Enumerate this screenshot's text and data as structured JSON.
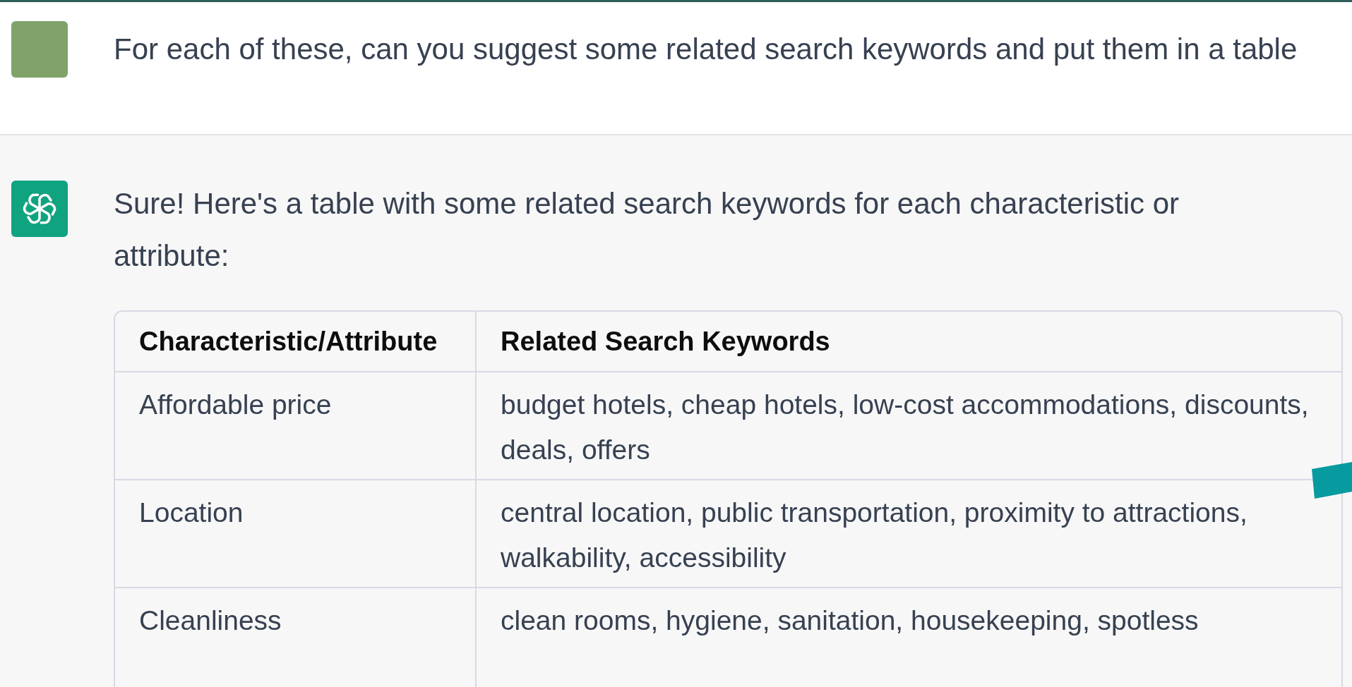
{
  "messages": [
    {
      "kind": "user",
      "text": "For each of these, can you suggest some related search keywords and put them in a table"
    },
    {
      "kind": "assistant",
      "text": "Sure! Here's a table with some related search keywords for each characteristic or attribute:",
      "table": {
        "columns": [
          "Characteristic/Attribute",
          "Related Search Keywords"
        ],
        "rows": [
          [
            "Affordable price",
            "budget hotels, cheap hotels, low-cost accommodations, discounts, deals, offers"
          ],
          [
            "Location",
            "central location, public transportation, proximity to attractions, walkability, accessibility"
          ],
          [
            "Cleanliness",
            "clean rooms, hygiene, sanitation, housekeeping, spotless"
          ]
        ]
      }
    }
  ]
}
